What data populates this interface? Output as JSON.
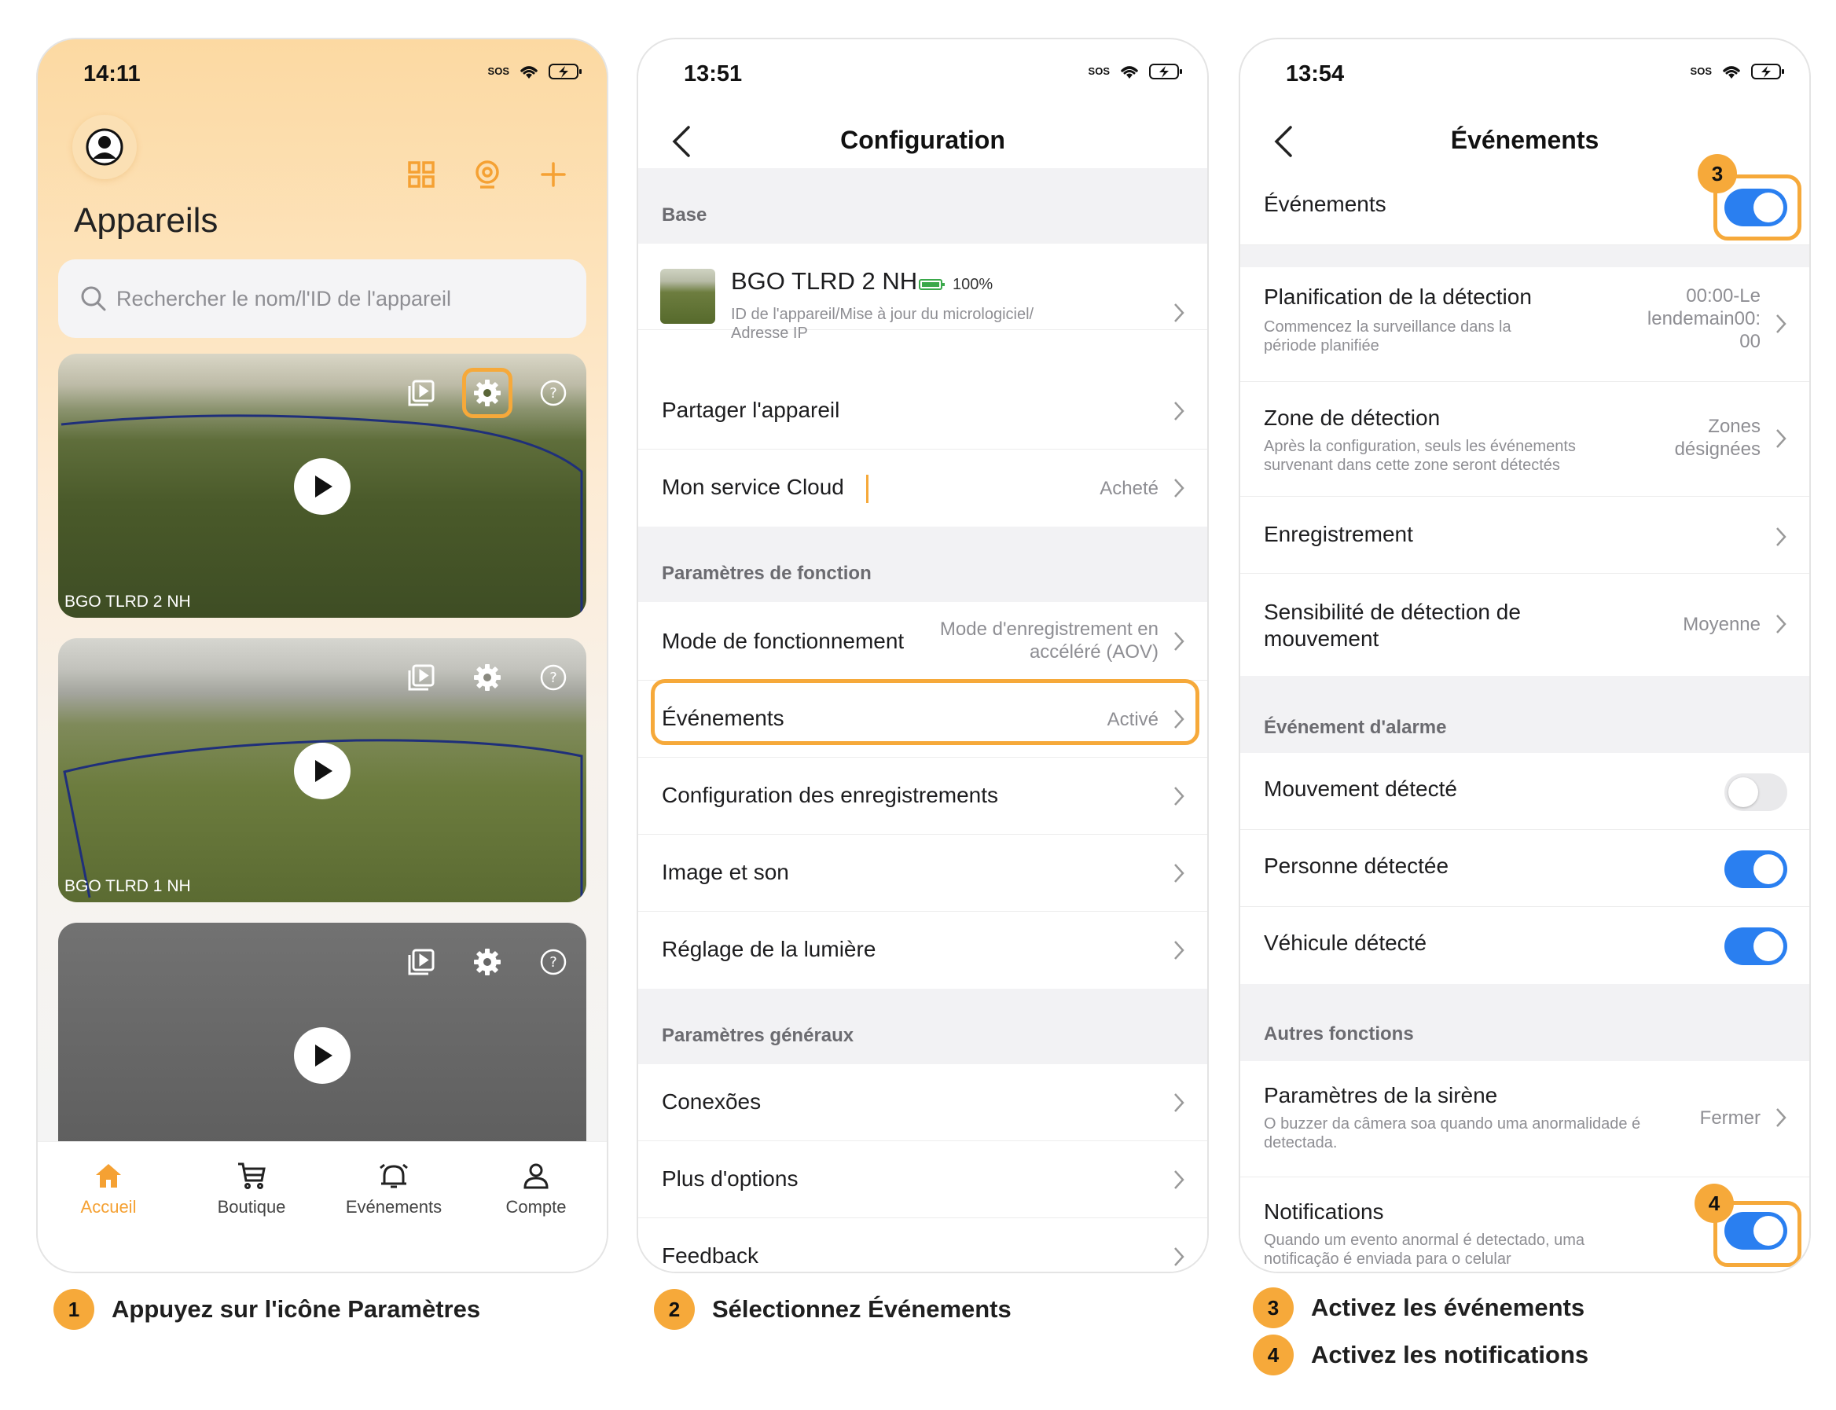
{
  "colors": {
    "accent": "#f6a93a",
    "toggle_on": "#2a7ff0",
    "tab_active": "#f5a133"
  },
  "phone1": {
    "status_time": "14:11",
    "sos": "SOS",
    "title": "Appareils",
    "search_placeholder": "Rechercher le nom/l'ID de l'appareil",
    "cameras": [
      {
        "name": "BGO TLRD 2 NH"
      },
      {
        "name": "BGO TLRD 1 NH"
      },
      {
        "name": ""
      }
    ],
    "tabs": [
      {
        "label": "Accueil",
        "icon": "home-icon",
        "active": true
      },
      {
        "label": "Boutique",
        "icon": "cart-icon",
        "active": false
      },
      {
        "label": "Evénements",
        "icon": "alarm-bell-icon",
        "active": false
      },
      {
        "label": "Compte",
        "icon": "person-icon",
        "active": false
      }
    ]
  },
  "phone2": {
    "status_time": "13:51",
    "sos": "SOS",
    "title": "Configuration",
    "sections": {
      "base": "Base",
      "fonction": "Paramètres de fonction",
      "generaux": "Paramètres généraux"
    },
    "device": {
      "name": "BGO TLRD 2 NH",
      "battery": "100%",
      "subtitle": "ID de l'appareil/Mise à jour du micrologiciel/ Adresse IP"
    },
    "rows": {
      "share": "Partager l'appareil",
      "cloud": "Mon service Cloud",
      "cloud_value": "Acheté",
      "mode": "Mode de fonctionnement",
      "mode_value": "Mode d'enregistrement en accéléré (AOV)",
      "events": "Événements",
      "events_value": "Activé",
      "recording": "Configuration des enregistrements",
      "image": "Image et son",
      "light": "Réglage de la lumière",
      "connections": "Conexões",
      "options": "Plus d'options",
      "feedback": "Feedback"
    }
  },
  "phone3": {
    "status_time": "13:54",
    "sos": "SOS",
    "title": "Événements",
    "events_toggle_label": "Événements",
    "events_toggle_on": true,
    "rows": {
      "planning": "Planification de la détection",
      "planning_sub": "Commencez la surveillance dans la période planifiée",
      "planning_value": "00:00-Le lendemain00: 00",
      "zone": "Zone de détection",
      "zone_sub": "Après la configuration, seuls les événements survenant dans cette zone seront détectés",
      "zone_value": "Zones désignées",
      "recording": "Enregistrement",
      "sensitivity": "Sensibilité de détection de mouvement",
      "sensitivity_value": "Moyenne"
    },
    "alarm_section": "Événement d'alarme",
    "alarms": [
      {
        "label": "Mouvement détecté",
        "on": false
      },
      {
        "label": "Personne détectée",
        "on": true
      },
      {
        "label": "Véhicule détecté",
        "on": true
      }
    ],
    "other_section": "Autres fonctions",
    "siren": "Paramètres de la sirène",
    "siren_sub": "O buzzer da câmera soa quando uma anormalidade é detectada.",
    "siren_value": "Fermer",
    "notifications": "Notifications",
    "notifications_sub": "Quando um evento anormal é detectado, uma notificação é enviada para o celular",
    "notifications_on": true
  },
  "markers": [
    "1",
    "2",
    "3",
    "4"
  ],
  "captions": [
    {
      "num": "1",
      "text": "Appuyez sur l'icône Paramètres"
    },
    {
      "num": "2",
      "text": "Sélectionnez Événements"
    },
    {
      "num": "3",
      "text": "Activez les événements"
    },
    {
      "num": "4",
      "text": "Activez les notifications"
    }
  ]
}
